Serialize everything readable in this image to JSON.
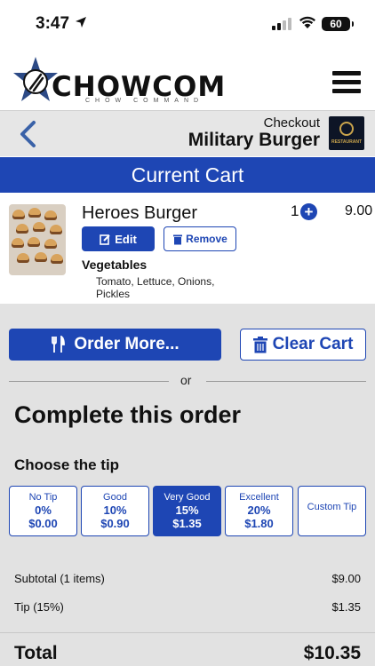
{
  "status": {
    "time": "3:47",
    "battery": "60"
  },
  "header": {
    "brand": "CHOWCOM",
    "tagline": "CHOW COMMAND"
  },
  "checkout": {
    "label": "Checkout",
    "restaurant": "Military Burger",
    "restaurant_logo_text": "RESTAURANT"
  },
  "cart": {
    "title": "Current Cart",
    "item": {
      "name": "Heroes Burger",
      "quantity": "1",
      "price": "9.00",
      "edit_label": "Edit",
      "remove_label": "Remove",
      "modifier_group": "Vegetables",
      "modifier_values": "Tomato, Lettuce, Onions, Pickles"
    }
  },
  "actions": {
    "order_more": "Order More...",
    "clear_cart": "Clear Cart",
    "or": "or"
  },
  "complete": {
    "title": "Complete this order",
    "tip_label": "Choose the tip",
    "tips": [
      {
        "name": "No Tip",
        "pct": "0%",
        "amount": "$0.00",
        "selected": false
      },
      {
        "name": "Good",
        "pct": "10%",
        "amount": "$0.90",
        "selected": false
      },
      {
        "name": "Very Good",
        "pct": "15%",
        "amount": "$1.35",
        "selected": true
      },
      {
        "name": "Excellent",
        "pct": "20%",
        "amount": "$1.80",
        "selected": false
      },
      {
        "name": "Custom Tip",
        "pct": "",
        "amount": "",
        "selected": false
      }
    ],
    "subtotal_label": "Subtotal (1 items)",
    "subtotal_value": "$9.00",
    "tip_row_label": "Tip (15%)",
    "tip_row_value": "$1.35",
    "total_label": "Total",
    "total_value": "$10.35"
  },
  "colors": {
    "accent": "#1e46b4",
    "background_section": "#e2e2e2"
  }
}
